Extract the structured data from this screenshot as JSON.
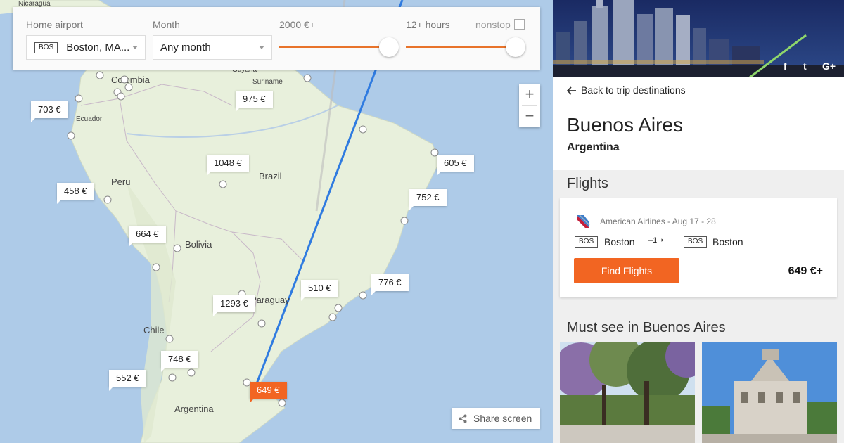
{
  "map": {
    "places": {
      "nicaragua": "Nicaragua",
      "colombia": "Colombia",
      "guyana": "Guyana",
      "suriname": "Suriname",
      "ecuador": "Ecuador",
      "peru": "Peru",
      "brazil": "Brazil",
      "bolivia": "Bolivia",
      "paraguay": "Paraguay",
      "chile": "Chile",
      "argentina": "Argentina"
    },
    "price_tags": [
      "703 €",
      "975 €",
      "1048 €",
      "605 €",
      "458 €",
      "752 €",
      "664 €",
      "510 €",
      "776 €",
      "1293 €",
      "748 €",
      "552 €",
      "649 €"
    ],
    "zoom_in": "+",
    "zoom_out": "−",
    "share_label": "Share screen",
    "colors": {
      "route": "#2f7be0",
      "active_tag": "#f26522",
      "water": "#aecbe8",
      "land": "#e8f0dc"
    }
  },
  "filters": {
    "home_airport_label": "Home airport",
    "home_airport_code": "BOS",
    "home_airport_value": "Boston, MA...",
    "month_label": "Month",
    "month_value": "Any month",
    "price_label": "2000 €+",
    "duration_label": "12+ hours",
    "nonstop_label": "nonstop",
    "nonstop_checked": false,
    "price_slider_level": 1.0,
    "duration_slider_level": 1.0
  },
  "panel": {
    "social": [
      "f",
      "t",
      "G+"
    ],
    "back_label": "Back to trip destinations",
    "city": "Buenos Aires",
    "country": "Argentina",
    "flights_heading": "Flights",
    "flight": {
      "airline": "American Airlines",
      "dates": "Aug 17 - 28",
      "from_code": "BOS",
      "from_city": "Boston",
      "stops": "1",
      "to_code": "BOS",
      "to_city": "Boston",
      "button_label": "Find Flights",
      "price": "649 €+"
    },
    "must_see_heading": "Must see in Buenos Aires"
  }
}
